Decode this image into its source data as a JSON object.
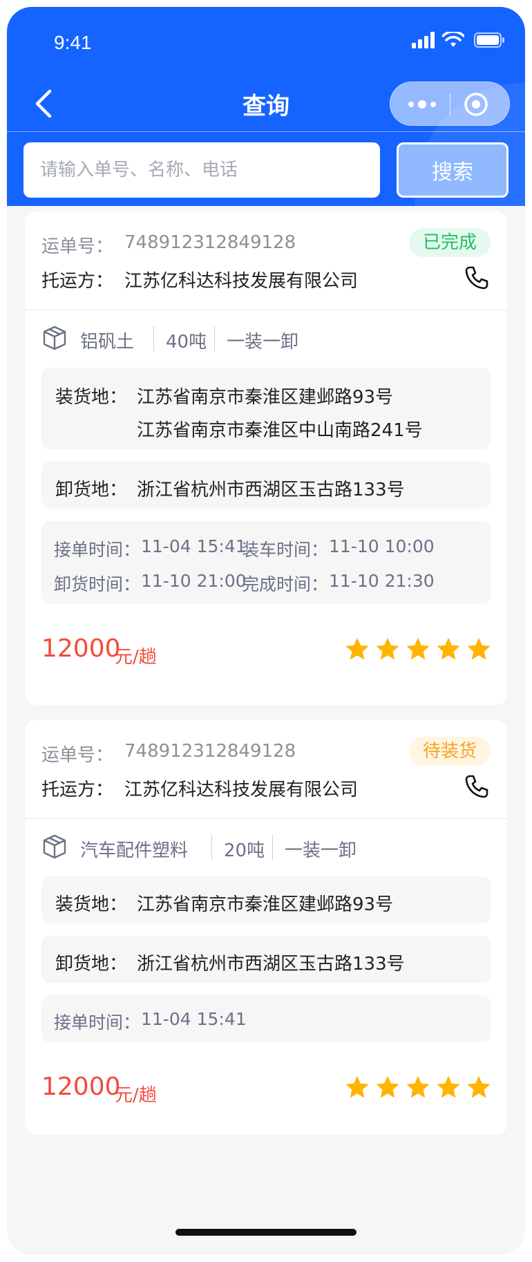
{
  "status_bar": {
    "time": "9:41"
  },
  "nav": {
    "title": "查询"
  },
  "search": {
    "placeholder": "请输入单号、名称、电话",
    "button_label": "搜索"
  },
  "labels": {
    "waybill": "运单号：",
    "shipper": "托运方：",
    "load_place": "装货地：",
    "unload_place": "卸货地：",
    "price_unit": "元/趟"
  },
  "colors": {
    "primary": "#1664ff",
    "status_done": "#22c064",
    "status_waiting": "#f5a623",
    "price": "#f24b3d",
    "star": "#ffb400"
  },
  "orders": [
    {
      "waybill_no": "748912312849128",
      "status": "已完成",
      "shipper": "江苏亿科达科技发展有限公司",
      "cargo_name": "铝矾土",
      "weight": "40吨",
      "mode": "一装一卸",
      "load_places": [
        "江苏省南京市秦淮区建邺路93号",
        "江苏省南京市秦淮区中山南路241号"
      ],
      "unload_place": "浙江省杭州市西湖区玉古路133号",
      "times": [
        {
          "label": "接单时间：",
          "value": "11-04 15:41"
        },
        {
          "label": "装车时间：",
          "value": "11-10 10:00"
        },
        {
          "label": "卸货时间：",
          "value": "11-10 21:00"
        },
        {
          "label": "完成时间：",
          "value": "11-10 21:30"
        }
      ],
      "price": "12000",
      "rating": 5
    },
    {
      "waybill_no": "748912312849128",
      "status": "待装货",
      "shipper": "江苏亿科达科技发展有限公司",
      "cargo_name": "汽车配件塑料",
      "weight": "20吨",
      "mode": "一装一卸",
      "load_places": [
        "江苏省南京市秦淮区建邺路93号"
      ],
      "unload_place": "浙江省杭州市西湖区玉古路133号",
      "times": [
        {
          "label": "接单时间：",
          "value": "11-04 15:41"
        }
      ],
      "price": "12000",
      "rating": 5
    }
  ]
}
